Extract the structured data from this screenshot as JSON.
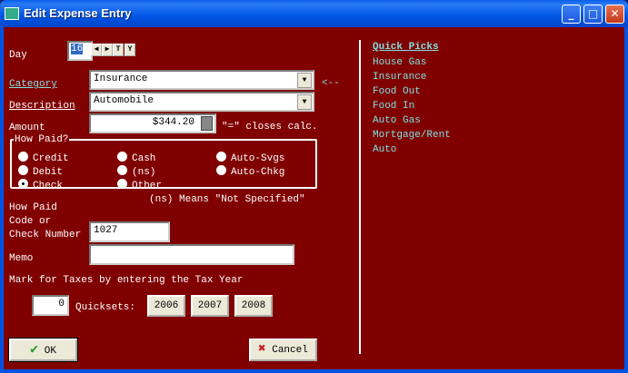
{
  "window": {
    "title": "Edit Expense Entry",
    "buttons": {
      "minimize": "_",
      "maximize": "□",
      "close": "✕"
    }
  },
  "day": {
    "label": "Day",
    "value": "16",
    "prev": "◀",
    "next": "▶",
    "today": "T",
    "yesterday": "Y"
  },
  "category": {
    "label": "Category",
    "value": "Insurance",
    "pointer": "<--"
  },
  "description": {
    "label": "Description",
    "value": "Automobile"
  },
  "amount": {
    "label": "Amount",
    "value": "$344.20",
    "hint": "\"=\" closes calc."
  },
  "how_paid": {
    "legend": "How Paid?",
    "options": [
      {
        "label": "Credit",
        "selected": false
      },
      {
        "label": "Debit",
        "selected": false
      },
      {
        "label": "Check",
        "selected": true
      },
      {
        "label": "Cash",
        "selected": false
      },
      {
        "label": "(ns)",
        "selected": false
      },
      {
        "label": "Other",
        "selected": false
      },
      {
        "label": "Auto-Svgs",
        "selected": false
      },
      {
        "label": "Auto-Chkg",
        "selected": false
      }
    ],
    "note": "(ns) Means \"Not Specified\""
  },
  "check": {
    "label1": "How Paid",
    "label2": "Code or",
    "label3": "Check Number",
    "value": "1027"
  },
  "memo": {
    "label": "Memo",
    "value": ""
  },
  "taxes": {
    "label": "Mark for Taxes by entering the Tax Year",
    "value": "0",
    "quicksets_label": "Quicksets:",
    "years": [
      "2006",
      "2007",
      "2008"
    ]
  },
  "ok_label": "OK",
  "cancel_label": "Cancel",
  "quick_picks": {
    "title": "Quick Picks",
    "items": [
      "House Gas",
      "Insurance",
      "Food Out",
      "Food In",
      "Auto Gas",
      "Mortgage/Rent",
      "Auto"
    ]
  }
}
